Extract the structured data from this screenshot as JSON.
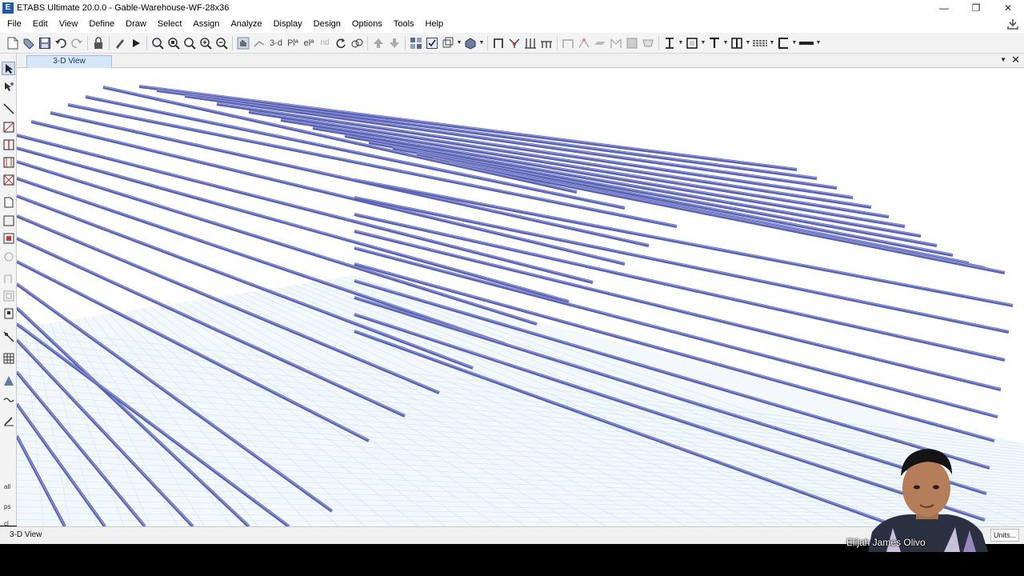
{
  "window": {
    "app_icon_letter": "E",
    "title": "ETABS Ultimate 20.0.0 - Gable-Warehouse-WF-28x36",
    "minimize_glyph": "—",
    "restore_glyph": "❐",
    "close_glyph": "✕"
  },
  "menu": {
    "items": [
      "File",
      "Edit",
      "View",
      "Define",
      "Draw",
      "Select",
      "Assign",
      "Analyze",
      "Display",
      "Design",
      "Options",
      "Tools",
      "Help"
    ]
  },
  "toolbar": {
    "view_3d_label": "3-d",
    "plan_label": "Plª",
    "elev_label": "elª",
    "nd_label": "nd"
  },
  "view": {
    "tab_label": "3-D View",
    "dropdown_glyph": "▼",
    "close_glyph": "✕"
  },
  "statusbar": {
    "view_label": "3-D View",
    "units_button": "Units..."
  },
  "overlay": {
    "presenter_name": "Elijah James Olivo"
  },
  "colors": {
    "member_blue": "#5b63b4",
    "grid_blue": "#cfe3ee",
    "tab_blue": "#d6e6f8"
  }
}
